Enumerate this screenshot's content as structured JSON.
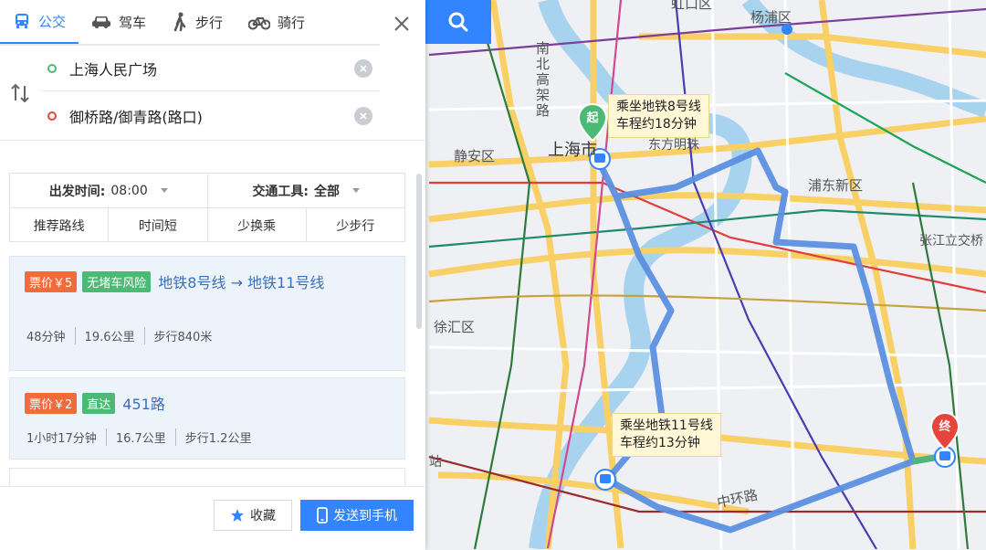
{
  "modes": [
    {
      "label": "公交",
      "icon": "bus-icon",
      "active": true
    },
    {
      "label": "驾车",
      "icon": "car-icon",
      "active": false
    },
    {
      "label": "步行",
      "icon": "walk-icon",
      "active": false
    },
    {
      "label": "骑行",
      "icon": "bike-icon",
      "active": false
    }
  ],
  "route": {
    "start": "上海人民广场",
    "end": "御桥路/御青路(路口)"
  },
  "options": {
    "depart_label": "出发时间:",
    "depart_value": "08:00",
    "transport_label": "交通工具:",
    "transport_value": "全部",
    "tabs": [
      "推荐路线",
      "时间短",
      "少换乘",
      "少步行"
    ]
  },
  "results": [
    {
      "price": "票价￥5",
      "tag": "无堵车风险",
      "name": "地铁8号线 → 地铁11号线",
      "duration": "48分钟",
      "distance": "19.6公里",
      "walk": "步行840米"
    },
    {
      "price": "票价￥2",
      "tag": "直达",
      "name": "451路",
      "duration": "1小时17分钟",
      "distance": "16.7公里",
      "walk": "步行1.2公里"
    }
  ],
  "actions": {
    "favorite": "收藏",
    "send": "发送到手机"
  },
  "map": {
    "labels": {
      "yangpu": "杨浦区",
      "nanbei": "南北高架路",
      "shanghai": "上海市",
      "dongfang": "东方明珠",
      "jingan": "静安区",
      "pudong": "浦东新区",
      "zhangjiang": "张江立交桥",
      "xuhui": "徐汇区",
      "zhonghuan": "中环路",
      "top": "虹口区",
      "station": "站"
    },
    "start_pin": "起",
    "end_pin": "终",
    "callout1": {
      "line1": "乘坐地铁8号线",
      "line2": "车程约18分钟"
    },
    "callout2": {
      "line1": "乘坐地铁11号线",
      "line2": "车程约13分钟"
    }
  },
  "colors": {
    "accent": "#3385ff",
    "route": "#5b8fe0",
    "price": "#f26b3a",
    "tag": "#4cba74"
  }
}
